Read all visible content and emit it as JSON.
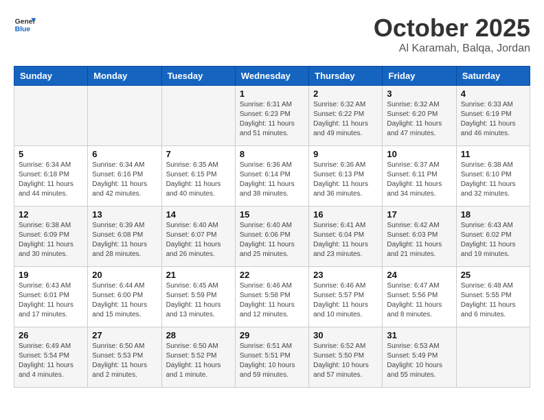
{
  "logo": {
    "line1": "General",
    "line2": "Blue"
  },
  "title": "October 2025",
  "subtitle": "Al Karamah, Balqa, Jordan",
  "weekdays": [
    "Sunday",
    "Monday",
    "Tuesday",
    "Wednesday",
    "Thursday",
    "Friday",
    "Saturday"
  ],
  "weeks": [
    [
      {
        "day": "",
        "sunrise": "",
        "sunset": "",
        "daylight": ""
      },
      {
        "day": "",
        "sunrise": "",
        "sunset": "",
        "daylight": ""
      },
      {
        "day": "",
        "sunrise": "",
        "sunset": "",
        "daylight": ""
      },
      {
        "day": "1",
        "sunrise": "Sunrise: 6:31 AM",
        "sunset": "Sunset: 6:23 PM",
        "daylight": "Daylight: 11 hours and 51 minutes."
      },
      {
        "day": "2",
        "sunrise": "Sunrise: 6:32 AM",
        "sunset": "Sunset: 6:22 PM",
        "daylight": "Daylight: 11 hours and 49 minutes."
      },
      {
        "day": "3",
        "sunrise": "Sunrise: 6:32 AM",
        "sunset": "Sunset: 6:20 PM",
        "daylight": "Daylight: 11 hours and 47 minutes."
      },
      {
        "day": "4",
        "sunrise": "Sunrise: 6:33 AM",
        "sunset": "Sunset: 6:19 PM",
        "daylight": "Daylight: 11 hours and 46 minutes."
      }
    ],
    [
      {
        "day": "5",
        "sunrise": "Sunrise: 6:34 AM",
        "sunset": "Sunset: 6:18 PM",
        "daylight": "Daylight: 11 hours and 44 minutes."
      },
      {
        "day": "6",
        "sunrise": "Sunrise: 6:34 AM",
        "sunset": "Sunset: 6:16 PM",
        "daylight": "Daylight: 11 hours and 42 minutes."
      },
      {
        "day": "7",
        "sunrise": "Sunrise: 6:35 AM",
        "sunset": "Sunset: 6:15 PM",
        "daylight": "Daylight: 11 hours and 40 minutes."
      },
      {
        "day": "8",
        "sunrise": "Sunrise: 6:36 AM",
        "sunset": "Sunset: 6:14 PM",
        "daylight": "Daylight: 11 hours and 38 minutes."
      },
      {
        "day": "9",
        "sunrise": "Sunrise: 6:36 AM",
        "sunset": "Sunset: 6:13 PM",
        "daylight": "Daylight: 11 hours and 36 minutes."
      },
      {
        "day": "10",
        "sunrise": "Sunrise: 6:37 AM",
        "sunset": "Sunset: 6:11 PM",
        "daylight": "Daylight: 11 hours and 34 minutes."
      },
      {
        "day": "11",
        "sunrise": "Sunrise: 6:38 AM",
        "sunset": "Sunset: 6:10 PM",
        "daylight": "Daylight: 11 hours and 32 minutes."
      }
    ],
    [
      {
        "day": "12",
        "sunrise": "Sunrise: 6:38 AM",
        "sunset": "Sunset: 6:09 PM",
        "daylight": "Daylight: 11 hours and 30 minutes."
      },
      {
        "day": "13",
        "sunrise": "Sunrise: 6:39 AM",
        "sunset": "Sunset: 6:08 PM",
        "daylight": "Daylight: 11 hours and 28 minutes."
      },
      {
        "day": "14",
        "sunrise": "Sunrise: 6:40 AM",
        "sunset": "Sunset: 6:07 PM",
        "daylight": "Daylight: 11 hours and 26 minutes."
      },
      {
        "day": "15",
        "sunrise": "Sunrise: 6:40 AM",
        "sunset": "Sunset: 6:06 PM",
        "daylight": "Daylight: 11 hours and 25 minutes."
      },
      {
        "day": "16",
        "sunrise": "Sunrise: 6:41 AM",
        "sunset": "Sunset: 6:04 PM",
        "daylight": "Daylight: 11 hours and 23 minutes."
      },
      {
        "day": "17",
        "sunrise": "Sunrise: 6:42 AM",
        "sunset": "Sunset: 6:03 PM",
        "daylight": "Daylight: 11 hours and 21 minutes."
      },
      {
        "day": "18",
        "sunrise": "Sunrise: 6:43 AM",
        "sunset": "Sunset: 6:02 PM",
        "daylight": "Daylight: 11 hours and 19 minutes."
      }
    ],
    [
      {
        "day": "19",
        "sunrise": "Sunrise: 6:43 AM",
        "sunset": "Sunset: 6:01 PM",
        "daylight": "Daylight: 11 hours and 17 minutes."
      },
      {
        "day": "20",
        "sunrise": "Sunrise: 6:44 AM",
        "sunset": "Sunset: 6:00 PM",
        "daylight": "Daylight: 11 hours and 15 minutes."
      },
      {
        "day": "21",
        "sunrise": "Sunrise: 6:45 AM",
        "sunset": "Sunset: 5:59 PM",
        "daylight": "Daylight: 11 hours and 13 minutes."
      },
      {
        "day": "22",
        "sunrise": "Sunrise: 6:46 AM",
        "sunset": "Sunset: 5:58 PM",
        "daylight": "Daylight: 11 hours and 12 minutes."
      },
      {
        "day": "23",
        "sunrise": "Sunrise: 6:46 AM",
        "sunset": "Sunset: 5:57 PM",
        "daylight": "Daylight: 11 hours and 10 minutes."
      },
      {
        "day": "24",
        "sunrise": "Sunrise: 6:47 AM",
        "sunset": "Sunset: 5:56 PM",
        "daylight": "Daylight: 11 hours and 8 minutes."
      },
      {
        "day": "25",
        "sunrise": "Sunrise: 6:48 AM",
        "sunset": "Sunset: 5:55 PM",
        "daylight": "Daylight: 11 hours and 6 minutes."
      }
    ],
    [
      {
        "day": "26",
        "sunrise": "Sunrise: 6:49 AM",
        "sunset": "Sunset: 5:54 PM",
        "daylight": "Daylight: 11 hours and 4 minutes."
      },
      {
        "day": "27",
        "sunrise": "Sunrise: 6:50 AM",
        "sunset": "Sunset: 5:53 PM",
        "daylight": "Daylight: 11 hours and 2 minutes."
      },
      {
        "day": "28",
        "sunrise": "Sunrise: 6:50 AM",
        "sunset": "Sunset: 5:52 PM",
        "daylight": "Daylight: 11 hours and 1 minute."
      },
      {
        "day": "29",
        "sunrise": "Sunrise: 6:51 AM",
        "sunset": "Sunset: 5:51 PM",
        "daylight": "Daylight: 10 hours and 59 minutes."
      },
      {
        "day": "30",
        "sunrise": "Sunrise: 6:52 AM",
        "sunset": "Sunset: 5:50 PM",
        "daylight": "Daylight: 10 hours and 57 minutes."
      },
      {
        "day": "31",
        "sunrise": "Sunrise: 6:53 AM",
        "sunset": "Sunset: 5:49 PM",
        "daylight": "Daylight: 10 hours and 55 minutes."
      },
      {
        "day": "",
        "sunrise": "",
        "sunset": "",
        "daylight": ""
      }
    ]
  ]
}
